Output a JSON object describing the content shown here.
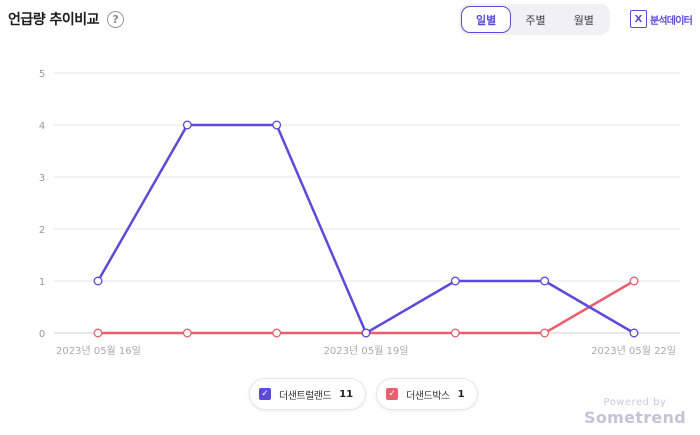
{
  "header": {
    "title": "언급량 추이비교",
    "help_icon": "?",
    "period_tabs": [
      {
        "label": "일별",
        "active": true
      },
      {
        "label": "주별",
        "active": false
      },
      {
        "label": "월별",
        "active": false
      }
    ],
    "analysis_icon": "X",
    "analysis_label": "분석데이터"
  },
  "chart_data": {
    "type": "line",
    "x": [
      "2023-05-16",
      "2023-05-17",
      "2023-05-18",
      "2023-05-19",
      "2023-05-20",
      "2023-05-21",
      "2023-05-22"
    ],
    "x_tick_labels": [
      {
        "index": 0,
        "label": "2023년 05월 16일"
      },
      {
        "index": 3,
        "label": "2023년 05월 19일"
      },
      {
        "index": 6,
        "label": "2023년 05월 22일"
      }
    ],
    "yticks": [
      0,
      1,
      2,
      3,
      4,
      5
    ],
    "ylim": [
      0,
      5
    ],
    "grid": true,
    "legend_position": "bottom-center",
    "series": [
      {
        "name": "더샌트럴랜드",
        "count": "11",
        "color": "#5b4bd8",
        "values": [
          1,
          4,
          4,
          0,
          1,
          1,
          0
        ]
      },
      {
        "name": "더샌드박스",
        "count": "1",
        "color": "#e8606f",
        "values": [
          0,
          0,
          0,
          0,
          0,
          0,
          1
        ]
      }
    ]
  },
  "footer": {
    "powered_by": "Powered by",
    "brand": "Sometrend"
  }
}
